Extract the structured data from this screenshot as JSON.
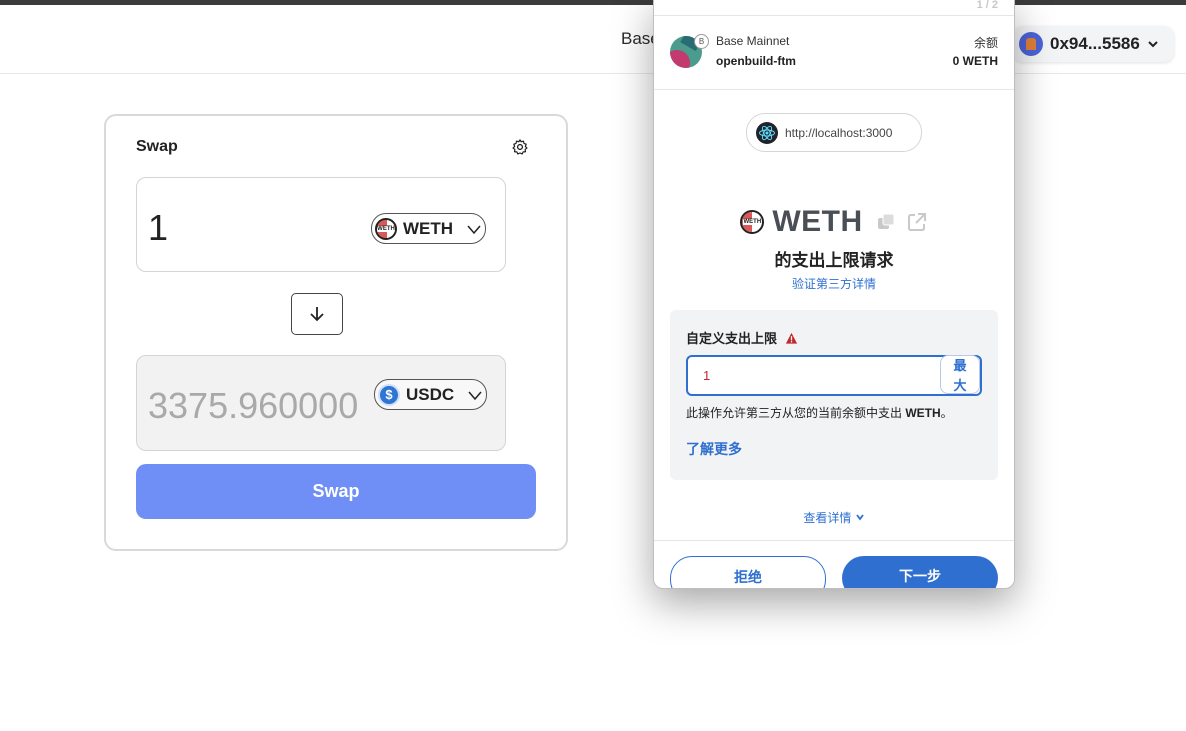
{
  "header": {
    "network_label": "Base",
    "account": {
      "address": "0x94...5586"
    }
  },
  "swap": {
    "title": "Swap",
    "input": {
      "amount": "1",
      "token": "WETH"
    },
    "output": {
      "amount": "3375.960000",
      "token": "USDC"
    },
    "button_label": "Swap"
  },
  "wallet": {
    "pager": "1 / 2",
    "network": "Base Mainnet",
    "account_name": "openbuild-ftm",
    "balance_label": "余额",
    "balance_value": "0 WETH",
    "origin": "http://localhost:3000",
    "asset_symbol": "WETH",
    "request_title": "的支出上限请求",
    "verify_link": "验证第三方详情",
    "custom_limit_label": "自定义支出上限",
    "limit_value": "1",
    "max_label": "最大",
    "desc_prefix": "此操作允许第三方从您的当前余额中支出 ",
    "desc_token": "WETH",
    "desc_suffix": "。",
    "learn_more": "了解更多",
    "view_details": "查看详情",
    "reject_label": "拒绝",
    "next_label": "下一步"
  },
  "icons": {
    "settings": "gear-icon",
    "flip": "arrow-down-icon",
    "copy": "copy-icon",
    "external": "external-link-icon",
    "warning": "warning-icon"
  },
  "colors": {
    "swap_button": "#6f8ff6",
    "wallet_primary": "#2f6fd0",
    "warning": "#c2272d"
  }
}
